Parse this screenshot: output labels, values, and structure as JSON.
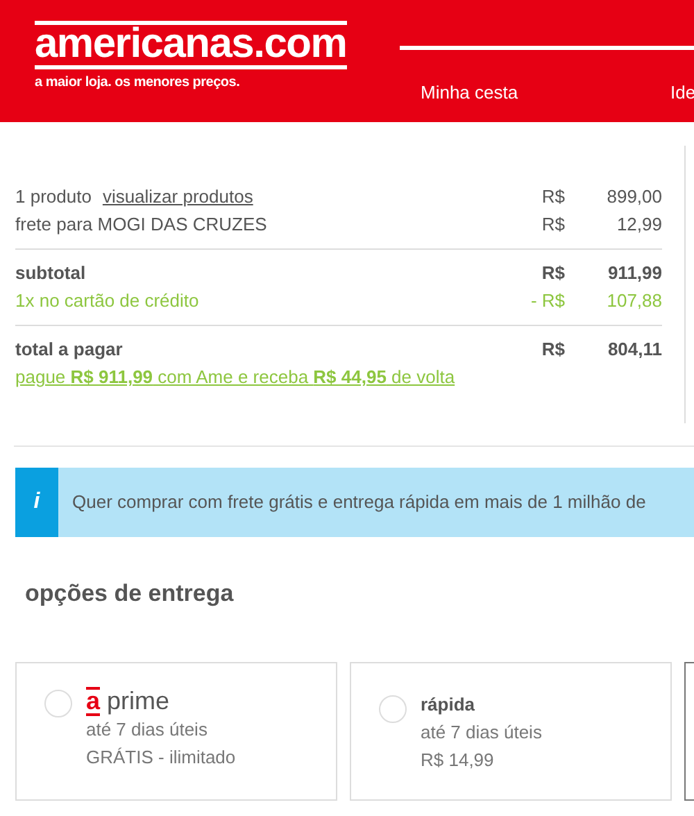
{
  "header": {
    "logo": "americanas.com",
    "tagline": "a maior loja. os menores preços.",
    "nav": [
      {
        "label": "Minha cesta"
      },
      {
        "label": "Ide"
      }
    ]
  },
  "summary": {
    "groups": [
      {
        "rows": [
          {
            "kind": "product",
            "label": "1 produto",
            "link": "visualizar produtos",
            "currency": "R$",
            "amount": "899,00"
          },
          {
            "kind": "plain",
            "label": "frete para MOGI DAS CRUZES",
            "currency": "R$",
            "amount": "12,99"
          }
        ]
      },
      {
        "rows": [
          {
            "kind": "bold",
            "label": "subtotal",
            "currency": "R$",
            "amount": "911,99"
          },
          {
            "kind": "discount",
            "label": "1x no cartão de crédito",
            "currency": "- R$",
            "amount": "107,88"
          }
        ]
      },
      {
        "rows": [
          {
            "kind": "bold",
            "label": "total a pagar",
            "currency": "R$",
            "amount": "804,11"
          }
        ]
      }
    ],
    "ame_link": "pague **R$ 911,99** com Ame e receba **R$ 44,95** de volta"
  },
  "info_banner": {
    "icon": "i",
    "text": "Quer comprar com frete grátis e entrega rápida em mais de 1 milhão de"
  },
  "delivery": {
    "heading": "opções de entrega",
    "options": [
      {
        "kind": "prime",
        "badge": "a",
        "title": "prime",
        "lines": [
          "até 7 dias úteis",
          "GRÁTIS - ilimitado"
        ],
        "selected": false
      },
      {
        "kind": "plain",
        "title": "rápida",
        "lines": [
          "até 7 dias úteis",
          "R$ 14,99"
        ],
        "selected": false
      }
    ]
  }
}
